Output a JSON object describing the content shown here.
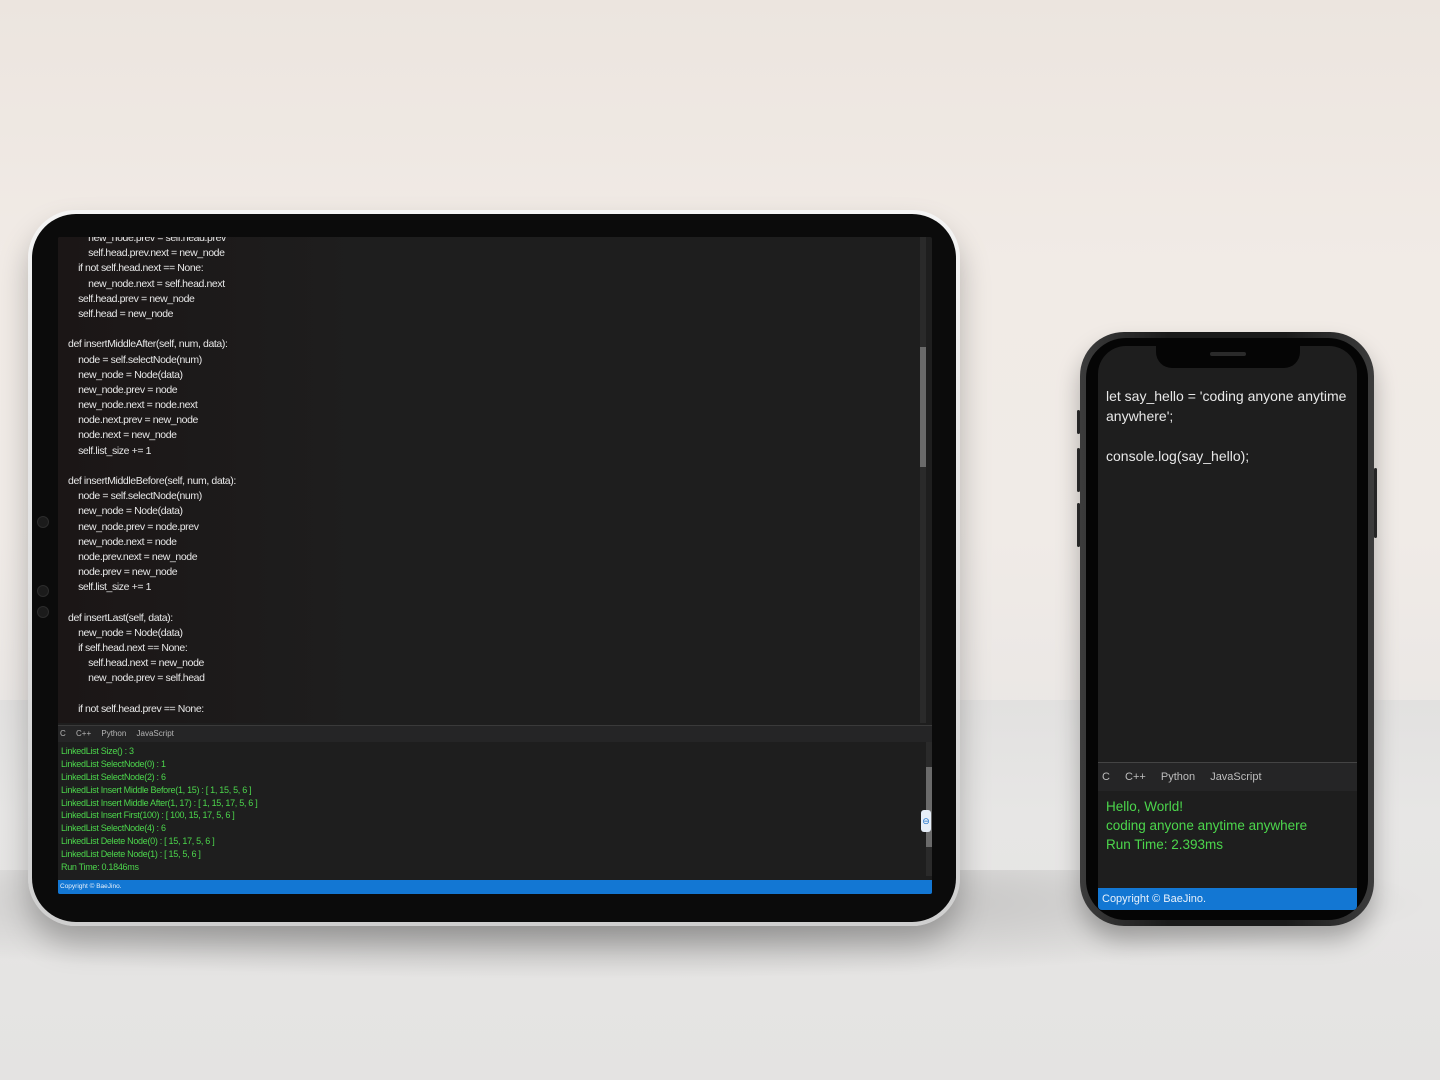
{
  "tablet": {
    "code_lines": [
      "        new_node.prev = self.head.prev",
      "        self.head.prev.next = new_node",
      "    if not self.head.next == None:",
      "        new_node.next = self.head.next",
      "    self.head.prev = new_node",
      "    self.head = new_node",
      "",
      "def insertMiddleAfter(self, num, data):",
      "    node = self.selectNode(num)",
      "    new_node = Node(data)",
      "    new_node.prev = node",
      "    new_node.next = node.next",
      "    node.next.prev = new_node",
      "    node.next = new_node",
      "    self.list_size += 1",
      "",
      "def insertMiddleBefore(self, num, data):",
      "    node = self.selectNode(num)",
      "    new_node = Node(data)",
      "    new_node.prev = node.prev",
      "    new_node.next = node",
      "    node.prev.next = new_node",
      "    node.prev = new_node",
      "    self.list_size += 1",
      "",
      "def insertLast(self, data):",
      "    new_node = Node(data)",
      "    if self.head.next == None:",
      "        self.head.next = new_node",
      "        new_node.prev = self.head",
      "",
      "    if not self.head.prev == None:"
    ],
    "tabs": [
      "C",
      "C++",
      "Python",
      "JavaScript"
    ],
    "output_lines": [
      "LinkedList Size() : 3",
      "LinkedList SelectNode(0) : 1",
      "LinkedList SelectNode(2) : 6",
      "LinkedList Insert Middle Before(1, 15) : [ 1, 15, 5, 6 ]",
      "LinkedList Insert Middle After(1, 17) : [ 1, 15, 17, 5, 6 ]",
      "LinkedList Insert First(100) : [ 100, 15, 17, 5, 6 ]",
      "LinkedList SelectNode(4) : 6",
      "LinkedList Delete Node(0) : [ 15, 17, 5, 6 ]",
      "LinkedList Delete Node(1) : [ 15, 5, 6 ]",
      "Run Time: 0.1846ms"
    ],
    "footer": "Copyright © BaeJino."
  },
  "phone": {
    "code_lines": [
      "let say_hello = 'coding anyone anytime anywhere';",
      "",
      "console.log(say_hello);"
    ],
    "tabs": [
      "C",
      "C++",
      "Python",
      "JavaScript"
    ],
    "output_lines": [
      "Hello, World!",
      "coding anyone anytime anywhere",
      "Run Time: 2.393ms"
    ],
    "footer": "Copyright © BaeJino."
  },
  "colors": {
    "editor_bg": "#1e1e1e",
    "output_text": "#4cd64c",
    "footer_bar": "#1377d3"
  }
}
